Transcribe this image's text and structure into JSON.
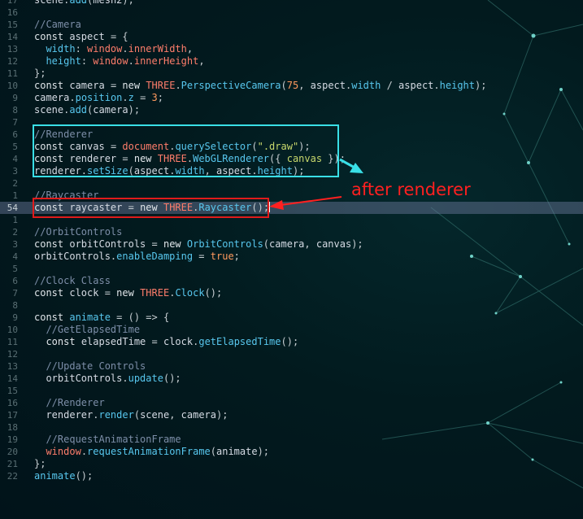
{
  "editor": {
    "current_line_number": "54",
    "lines": [
      {
        "num": "17",
        "tokens": [
          [
            "scene",
            "v"
          ],
          [
            ".",
            "x"
          ],
          [
            "add",
            "p"
          ],
          [
            "(",
            "x"
          ],
          [
            "mesh2",
            "v"
          ],
          [
            ");",
            "x"
          ]
        ]
      },
      {
        "num": "16",
        "tokens": []
      },
      {
        "num": "15",
        "tokens": [
          [
            "//Camera",
            "c"
          ]
        ]
      },
      {
        "num": "14",
        "tokens": [
          [
            "const ",
            "k"
          ],
          [
            "aspect",
            "v"
          ],
          [
            " = {",
            "x"
          ]
        ]
      },
      {
        "num": "13",
        "tokens": [
          [
            "  ",
            "x"
          ],
          [
            "width",
            "p"
          ],
          [
            ": ",
            "x"
          ],
          [
            "window",
            "g"
          ],
          [
            ".",
            "x"
          ],
          [
            "innerWidth",
            "g"
          ],
          [
            ",",
            "x"
          ]
        ]
      },
      {
        "num": "12",
        "tokens": [
          [
            "  ",
            "x"
          ],
          [
            "height",
            "p"
          ],
          [
            ": ",
            "x"
          ],
          [
            "window",
            "g"
          ],
          [
            ".",
            "x"
          ],
          [
            "innerHeight",
            "g"
          ],
          [
            ",",
            "x"
          ]
        ]
      },
      {
        "num": "11",
        "tokens": [
          [
            "};",
            "x"
          ]
        ]
      },
      {
        "num": "10",
        "tokens": [
          [
            "const ",
            "k"
          ],
          [
            "camera",
            "v"
          ],
          [
            " = ",
            "x"
          ],
          [
            "new ",
            "k"
          ],
          [
            "THREE",
            "g"
          ],
          [
            ".",
            "x"
          ],
          [
            "PerspectiveCamera",
            "p"
          ],
          [
            "(",
            "x"
          ],
          [
            "75",
            "n"
          ],
          [
            ", ",
            "x"
          ],
          [
            "aspect",
            "v"
          ],
          [
            ".",
            "x"
          ],
          [
            "width",
            "p"
          ],
          [
            " / ",
            "x"
          ],
          [
            "aspect",
            "v"
          ],
          [
            ".",
            "x"
          ],
          [
            "height",
            "p"
          ],
          [
            ");",
            "x"
          ]
        ]
      },
      {
        "num": "9",
        "tokens": [
          [
            "camera",
            "v"
          ],
          [
            ".",
            "x"
          ],
          [
            "position",
            "p"
          ],
          [
            ".",
            "x"
          ],
          [
            "z",
            "p"
          ],
          [
            " = ",
            "x"
          ],
          [
            "3",
            "n"
          ],
          [
            ";",
            "x"
          ]
        ]
      },
      {
        "num": "8",
        "tokens": [
          [
            "scene",
            "v"
          ],
          [
            ".",
            "x"
          ],
          [
            "add",
            "p"
          ],
          [
            "(",
            "x"
          ],
          [
            "camera",
            "v"
          ],
          [
            ");",
            "x"
          ]
        ]
      },
      {
        "num": "7",
        "tokens": []
      },
      {
        "num": "6",
        "tokens": [
          [
            "//Renderer",
            "c"
          ]
        ]
      },
      {
        "num": "5",
        "tokens": [
          [
            "const ",
            "k"
          ],
          [
            "canvas",
            "v"
          ],
          [
            " = ",
            "x"
          ],
          [
            "document",
            "g"
          ],
          [
            ".",
            "x"
          ],
          [
            "querySelector",
            "p"
          ],
          [
            "(",
            "x"
          ],
          [
            "\".draw\"",
            "s"
          ],
          [
            ");",
            "x"
          ]
        ]
      },
      {
        "num": "4",
        "tokens": [
          [
            "const ",
            "k"
          ],
          [
            "renderer",
            "v"
          ],
          [
            " = ",
            "x"
          ],
          [
            "new ",
            "k"
          ],
          [
            "THREE",
            "g"
          ],
          [
            ".",
            "x"
          ],
          [
            "WebGLRenderer",
            "p"
          ],
          [
            "({ ",
            "x"
          ],
          [
            "canvas",
            "s"
          ],
          [
            " });",
            "x"
          ]
        ]
      },
      {
        "num": "3",
        "tokens": [
          [
            "renderer",
            "v"
          ],
          [
            ".",
            "x"
          ],
          [
            "setSize",
            "p"
          ],
          [
            "(",
            "x"
          ],
          [
            "aspect",
            "v"
          ],
          [
            ".",
            "x"
          ],
          [
            "width",
            "p"
          ],
          [
            ", ",
            "x"
          ],
          [
            "aspect",
            "v"
          ],
          [
            ".",
            "x"
          ],
          [
            "height",
            "p"
          ],
          [
            ");",
            "x"
          ]
        ]
      },
      {
        "num": "2",
        "tokens": []
      },
      {
        "num": "1",
        "tokens": [
          [
            "//Raycaster",
            "c"
          ]
        ]
      },
      {
        "num": "54",
        "tokens": [
          [
            "const ",
            "k"
          ],
          [
            "raycaster",
            "v"
          ],
          [
            " = ",
            "x"
          ],
          [
            "new ",
            "k"
          ],
          [
            "THREE",
            "g"
          ],
          [
            ".",
            "x"
          ],
          [
            "Raycaster",
            "p"
          ],
          [
            "();",
            "x"
          ]
        ]
      },
      {
        "num": "1",
        "tokens": []
      },
      {
        "num": "2",
        "tokens": [
          [
            "//OrbitControls",
            "c"
          ]
        ]
      },
      {
        "num": "3",
        "tokens": [
          [
            "const ",
            "k"
          ],
          [
            "orbitControls",
            "v"
          ],
          [
            " = ",
            "x"
          ],
          [
            "new ",
            "k"
          ],
          [
            "OrbitControls",
            "p"
          ],
          [
            "(",
            "x"
          ],
          [
            "camera",
            "v"
          ],
          [
            ", ",
            "x"
          ],
          [
            "canvas",
            "v"
          ],
          [
            ");",
            "x"
          ]
        ]
      },
      {
        "num": "4",
        "tokens": [
          [
            "orbitControls",
            "v"
          ],
          [
            ".",
            "x"
          ],
          [
            "enableDamping",
            "p"
          ],
          [
            " = ",
            "x"
          ],
          [
            "true",
            "b"
          ],
          [
            ";",
            "x"
          ]
        ]
      },
      {
        "num": "5",
        "tokens": []
      },
      {
        "num": "6",
        "tokens": [
          [
            "//Clock Class",
            "c"
          ]
        ]
      },
      {
        "num": "7",
        "tokens": [
          [
            "const ",
            "k"
          ],
          [
            "clock",
            "v"
          ],
          [
            " = ",
            "x"
          ],
          [
            "new ",
            "k"
          ],
          [
            "THREE",
            "g"
          ],
          [
            ".",
            "x"
          ],
          [
            "Clock",
            "p"
          ],
          [
            "();",
            "x"
          ]
        ]
      },
      {
        "num": "8",
        "tokens": []
      },
      {
        "num": "9",
        "tokens": [
          [
            "const ",
            "k"
          ],
          [
            "animate",
            "p"
          ],
          [
            " = () => {",
            "x"
          ]
        ]
      },
      {
        "num": "10",
        "tokens": [
          [
            "  ",
            "x"
          ],
          [
            "//GetElapsedTime",
            "c"
          ]
        ]
      },
      {
        "num": "11",
        "tokens": [
          [
            "  ",
            "x"
          ],
          [
            "const ",
            "k"
          ],
          [
            "elapsedTime",
            "v"
          ],
          [
            " = ",
            "x"
          ],
          [
            "clock",
            "v"
          ],
          [
            ".",
            "x"
          ],
          [
            "getElapsedTime",
            "p"
          ],
          [
            "();",
            "x"
          ]
        ]
      },
      {
        "num": "12",
        "tokens": []
      },
      {
        "num": "13",
        "tokens": [
          [
            "  ",
            "x"
          ],
          [
            "//Update Controls",
            "c"
          ]
        ]
      },
      {
        "num": "14",
        "tokens": [
          [
            "  ",
            "x"
          ],
          [
            "orbitControls",
            "v"
          ],
          [
            ".",
            "x"
          ],
          [
            "update",
            "p"
          ],
          [
            "();",
            "x"
          ]
        ]
      },
      {
        "num": "15",
        "tokens": []
      },
      {
        "num": "16",
        "tokens": [
          [
            "  ",
            "x"
          ],
          [
            "//Renderer",
            "c"
          ]
        ]
      },
      {
        "num": "17",
        "tokens": [
          [
            "  ",
            "x"
          ],
          [
            "renderer",
            "v"
          ],
          [
            ".",
            "x"
          ],
          [
            "render",
            "p"
          ],
          [
            "(",
            "x"
          ],
          [
            "scene",
            "v"
          ],
          [
            ", ",
            "x"
          ],
          [
            "camera",
            "v"
          ],
          [
            ");",
            "x"
          ]
        ]
      },
      {
        "num": "18",
        "tokens": []
      },
      {
        "num": "19",
        "tokens": [
          [
            "  ",
            "x"
          ],
          [
            "//RequestAnimationFrame",
            "c"
          ]
        ]
      },
      {
        "num": "20",
        "tokens": [
          [
            "  ",
            "x"
          ],
          [
            "window",
            "g"
          ],
          [
            ".",
            "x"
          ],
          [
            "requestAnimationFrame",
            "p"
          ],
          [
            "(",
            "x"
          ],
          [
            "animate",
            "v"
          ],
          [
            ");",
            "x"
          ]
        ]
      },
      {
        "num": "21",
        "tokens": [
          [
            "};",
            "x"
          ]
        ]
      },
      {
        "num": "22",
        "tokens": [
          [
            "animate",
            "p"
          ],
          [
            "();",
            "x"
          ]
        ]
      }
    ]
  },
  "annotation": {
    "text": "after renderer"
  },
  "colors": {
    "highlight_box_cyan": "#39dfe6",
    "highlight_box_red": "#e01b1b",
    "annotation_red": "#ff2020",
    "current_line": "#4a5570"
  }
}
